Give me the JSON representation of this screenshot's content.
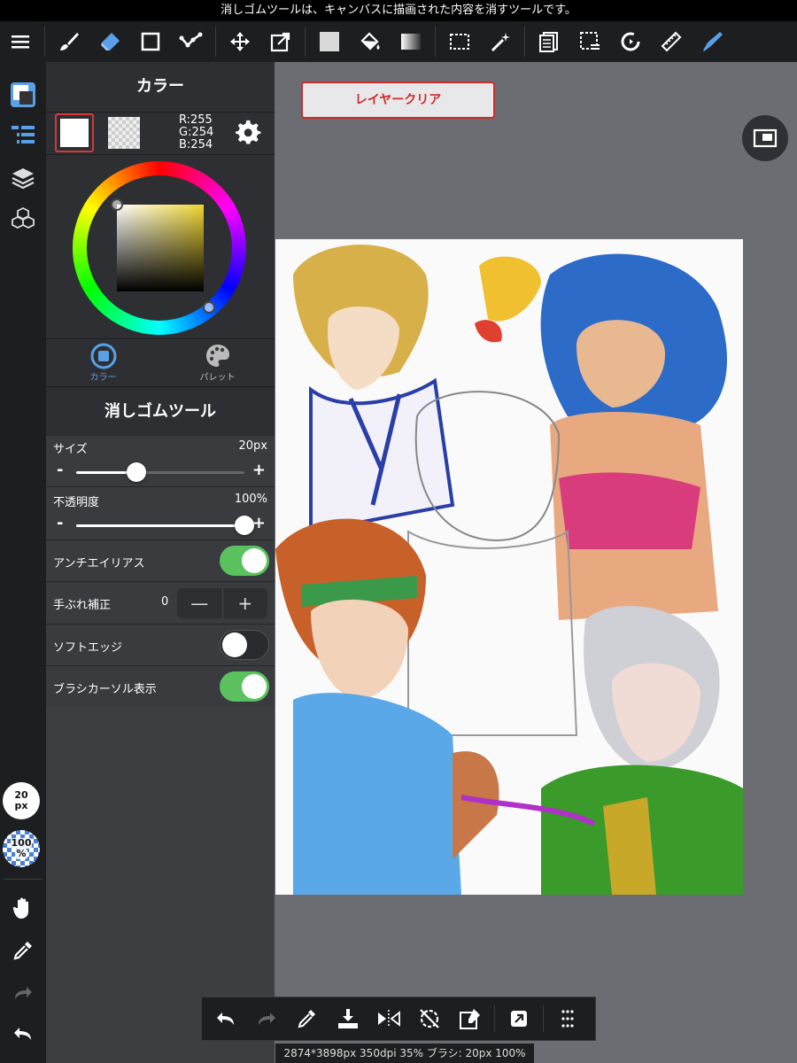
{
  "hint": "消しゴムツールは、キャンバスに描画された内容を消すツールです。",
  "toolbar": {
    "tools": [
      "menu-icon",
      "brush-icon",
      "eraser-icon",
      "rectangle-icon",
      "polyline-icon",
      "move-icon",
      "transform-icon",
      "fill-color-icon",
      "bucket-icon",
      "gradient-icon",
      "selection-icon",
      "magic-wand-icon",
      "copy-icon",
      "select-mode-icon",
      "rotate-icon",
      "ruler-icon",
      "pen-icon"
    ]
  },
  "rail": {
    "brush_size": "20",
    "brush_size_unit": "px",
    "opacity": "100",
    "opacity_unit": "%"
  },
  "color_panel": {
    "title": "カラー",
    "r": "R:255",
    "g": "G:254",
    "b": "B:254",
    "tab_color": "カラー",
    "tab_palette": "パレット",
    "accent": "#5aa0e8"
  },
  "tool_panel": {
    "title": "消しゴムツール",
    "size_label": "サイズ",
    "size_value": "20px",
    "size_fraction": 0.36,
    "opacity_label": "不透明度",
    "opacity_value": "100%",
    "opacity_fraction": 1.0,
    "antialias_label": "アンチエイリアス",
    "antialias_on": true,
    "stabilizer_label": "手ぶれ補正",
    "stabilizer_value": "0",
    "stabilizer_minus": "—",
    "stabilizer_plus": "+",
    "softedge_label": "ソフトエッジ",
    "softedge_on": false,
    "cursor_label": "ブラシカーソル表示",
    "cursor_on": true
  },
  "canvas": {
    "clear_button": "レイヤークリア"
  },
  "actions": [
    "undo-icon",
    "redo-icon",
    "eyedropper-icon",
    "save-icon",
    "flip-icon",
    "rotate-reset-icon",
    "eraser-select-icon",
    "share-icon",
    "more-icon"
  ],
  "status": "2874*3898px 350dpi 35% ブラシ: 20px 100%"
}
